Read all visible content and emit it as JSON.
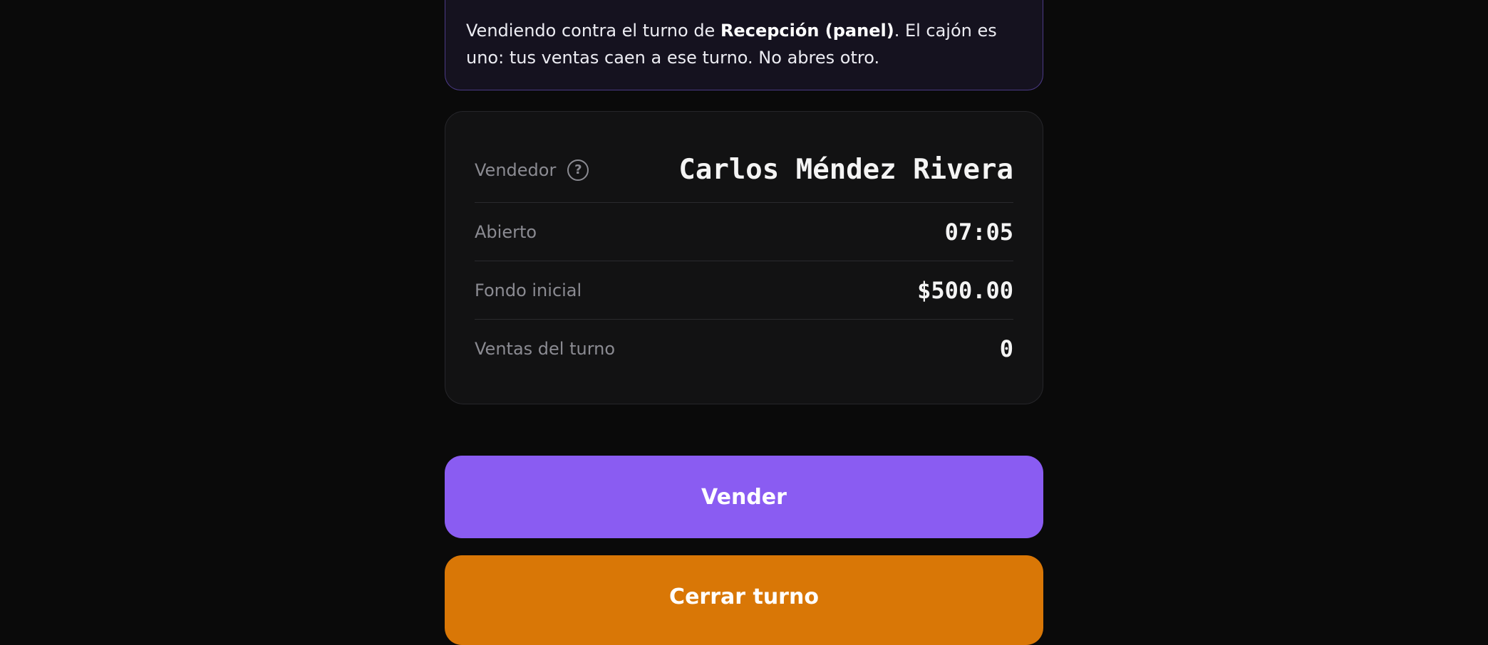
{
  "notice": {
    "prefix": "Vendiendo contra el turno de ",
    "shift_name": "Recepción (panel)",
    "suffix": ". El cajón es uno: tus ventas caen a ese turno. No abres otro."
  },
  "shift": {
    "seller_label": "Vendedor",
    "seller_help_icon": "question-circle-icon",
    "seller_value": "Carlos Méndez Rivera",
    "opened_label": "Abierto",
    "opened_value": "07:05",
    "float_label": "Fondo inicial",
    "float_value": "$500.00",
    "sales_label": "Ventas del turno",
    "sales_value": "0"
  },
  "actions": {
    "sell_label": "Vender",
    "close_label": "Cerrar turno"
  },
  "colors": {
    "background": "#0a0a0a",
    "notice_border": "#4b3a86",
    "sell_button": "#8a5cf2",
    "close_button": "#d97706"
  }
}
